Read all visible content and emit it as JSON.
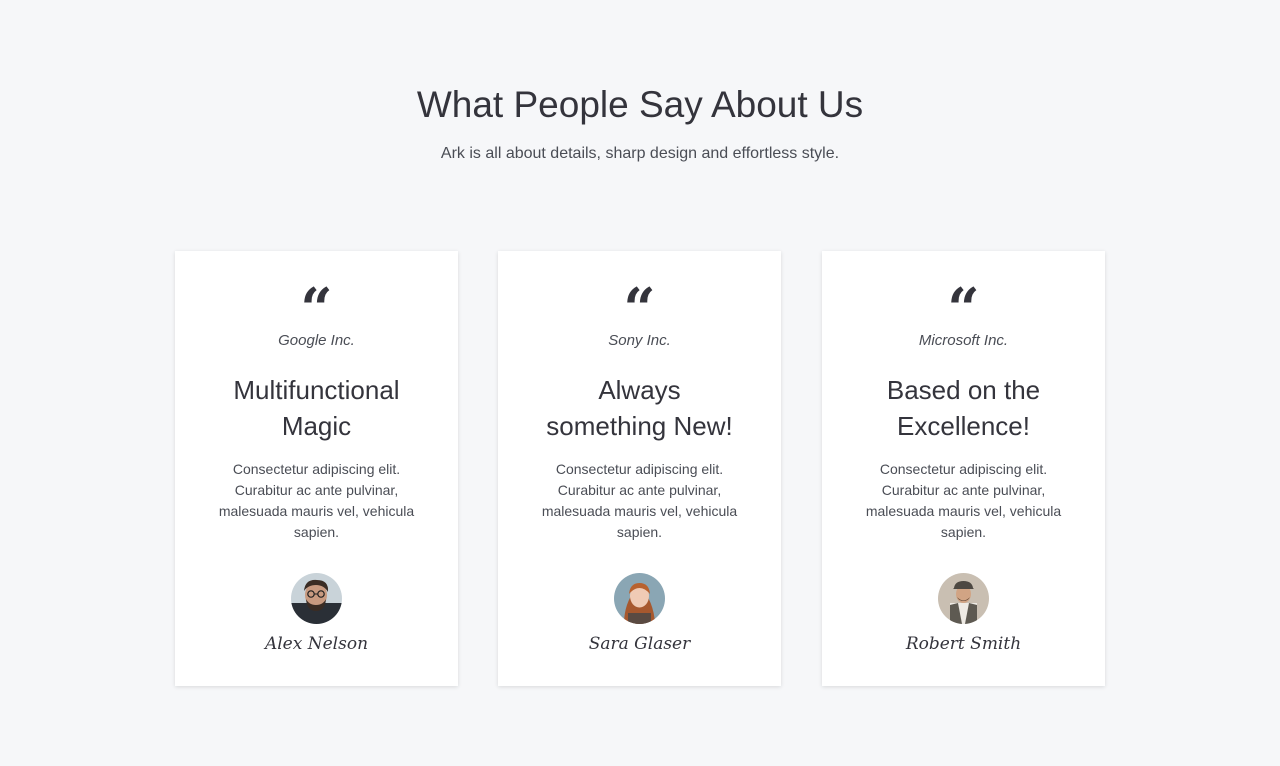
{
  "section": {
    "title": "What People Say About Us",
    "subtitle": "Ark is all about details, sharp design and effortless style."
  },
  "testimonials": [
    {
      "quote_icon": "quote-open-icon",
      "quote_glyph": "“",
      "company": "Google Inc.",
      "heading": "Multifunctional Magic",
      "body": "Consectetur adipiscing elit. Curabitur ac ante pulvinar, malesuada mauris vel, vehicula sapien.",
      "name": "Alex Nelson",
      "avatar": "avatar-photo"
    },
    {
      "quote_icon": "quote-open-icon",
      "quote_glyph": "“",
      "company": "Sony Inc.",
      "heading": "Always something New!",
      "body": "Consectetur adipiscing elit. Curabitur ac ante pulvinar, malesuada mauris vel, vehicula sapien.",
      "name": "Sara Glaser",
      "avatar": "avatar-photo"
    },
    {
      "quote_icon": "quote-open-icon",
      "quote_glyph": "“",
      "company": "Microsoft Inc.",
      "heading": "Based on the Excellence!",
      "body": "Consectetur adipiscing elit. Curabitur ac ante pulvinar, malesuada mauris vel, vehicula sapien.",
      "name": "Robert Smith",
      "avatar": "avatar-photo"
    }
  ],
  "colors": {
    "background": "#f6f7f9",
    "card": "#ffffff",
    "text": "#34343c"
  }
}
